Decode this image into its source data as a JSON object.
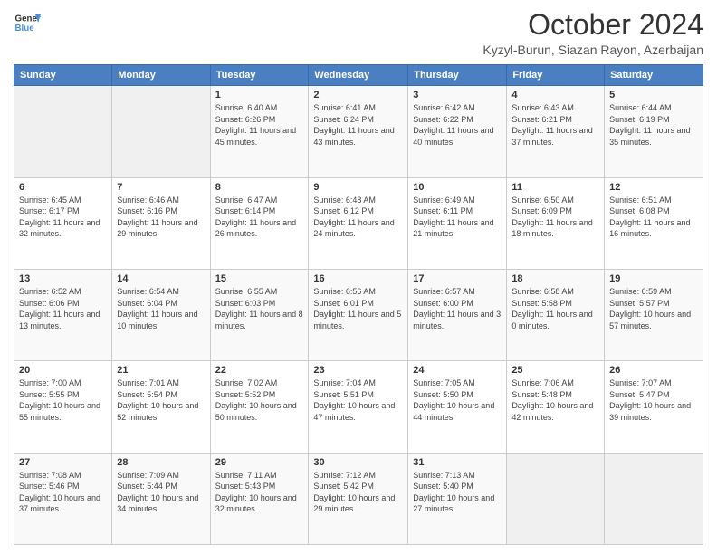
{
  "header": {
    "logo_line1": "General",
    "logo_line2": "Blue",
    "title": "October 2024",
    "subtitle": "Kyzyl-Burun, Siazan Rayon, Azerbaijan"
  },
  "columns": [
    "Sunday",
    "Monday",
    "Tuesday",
    "Wednesday",
    "Thursday",
    "Friday",
    "Saturday"
  ],
  "weeks": [
    [
      {
        "day": "",
        "info": ""
      },
      {
        "day": "",
        "info": ""
      },
      {
        "day": "1",
        "info": "Sunrise: 6:40 AM\nSunset: 6:26 PM\nDaylight: 11 hours and 45 minutes."
      },
      {
        "day": "2",
        "info": "Sunrise: 6:41 AM\nSunset: 6:24 PM\nDaylight: 11 hours and 43 minutes."
      },
      {
        "day": "3",
        "info": "Sunrise: 6:42 AM\nSunset: 6:22 PM\nDaylight: 11 hours and 40 minutes."
      },
      {
        "day": "4",
        "info": "Sunrise: 6:43 AM\nSunset: 6:21 PM\nDaylight: 11 hours and 37 minutes."
      },
      {
        "day": "5",
        "info": "Sunrise: 6:44 AM\nSunset: 6:19 PM\nDaylight: 11 hours and 35 minutes."
      }
    ],
    [
      {
        "day": "6",
        "info": "Sunrise: 6:45 AM\nSunset: 6:17 PM\nDaylight: 11 hours and 32 minutes."
      },
      {
        "day": "7",
        "info": "Sunrise: 6:46 AM\nSunset: 6:16 PM\nDaylight: 11 hours and 29 minutes."
      },
      {
        "day": "8",
        "info": "Sunrise: 6:47 AM\nSunset: 6:14 PM\nDaylight: 11 hours and 26 minutes."
      },
      {
        "day": "9",
        "info": "Sunrise: 6:48 AM\nSunset: 6:12 PM\nDaylight: 11 hours and 24 minutes."
      },
      {
        "day": "10",
        "info": "Sunrise: 6:49 AM\nSunset: 6:11 PM\nDaylight: 11 hours and 21 minutes."
      },
      {
        "day": "11",
        "info": "Sunrise: 6:50 AM\nSunset: 6:09 PM\nDaylight: 11 hours and 18 minutes."
      },
      {
        "day": "12",
        "info": "Sunrise: 6:51 AM\nSunset: 6:08 PM\nDaylight: 11 hours and 16 minutes."
      }
    ],
    [
      {
        "day": "13",
        "info": "Sunrise: 6:52 AM\nSunset: 6:06 PM\nDaylight: 11 hours and 13 minutes."
      },
      {
        "day": "14",
        "info": "Sunrise: 6:54 AM\nSunset: 6:04 PM\nDaylight: 11 hours and 10 minutes."
      },
      {
        "day": "15",
        "info": "Sunrise: 6:55 AM\nSunset: 6:03 PM\nDaylight: 11 hours and 8 minutes."
      },
      {
        "day": "16",
        "info": "Sunrise: 6:56 AM\nSunset: 6:01 PM\nDaylight: 11 hours and 5 minutes."
      },
      {
        "day": "17",
        "info": "Sunrise: 6:57 AM\nSunset: 6:00 PM\nDaylight: 11 hours and 3 minutes."
      },
      {
        "day": "18",
        "info": "Sunrise: 6:58 AM\nSunset: 5:58 PM\nDaylight: 11 hours and 0 minutes."
      },
      {
        "day": "19",
        "info": "Sunrise: 6:59 AM\nSunset: 5:57 PM\nDaylight: 10 hours and 57 minutes."
      }
    ],
    [
      {
        "day": "20",
        "info": "Sunrise: 7:00 AM\nSunset: 5:55 PM\nDaylight: 10 hours and 55 minutes."
      },
      {
        "day": "21",
        "info": "Sunrise: 7:01 AM\nSunset: 5:54 PM\nDaylight: 10 hours and 52 minutes."
      },
      {
        "day": "22",
        "info": "Sunrise: 7:02 AM\nSunset: 5:52 PM\nDaylight: 10 hours and 50 minutes."
      },
      {
        "day": "23",
        "info": "Sunrise: 7:04 AM\nSunset: 5:51 PM\nDaylight: 10 hours and 47 minutes."
      },
      {
        "day": "24",
        "info": "Sunrise: 7:05 AM\nSunset: 5:50 PM\nDaylight: 10 hours and 44 minutes."
      },
      {
        "day": "25",
        "info": "Sunrise: 7:06 AM\nSunset: 5:48 PM\nDaylight: 10 hours and 42 minutes."
      },
      {
        "day": "26",
        "info": "Sunrise: 7:07 AM\nSunset: 5:47 PM\nDaylight: 10 hours and 39 minutes."
      }
    ],
    [
      {
        "day": "27",
        "info": "Sunrise: 7:08 AM\nSunset: 5:46 PM\nDaylight: 10 hours and 37 minutes."
      },
      {
        "day": "28",
        "info": "Sunrise: 7:09 AM\nSunset: 5:44 PM\nDaylight: 10 hours and 34 minutes."
      },
      {
        "day": "29",
        "info": "Sunrise: 7:11 AM\nSunset: 5:43 PM\nDaylight: 10 hours and 32 minutes."
      },
      {
        "day": "30",
        "info": "Sunrise: 7:12 AM\nSunset: 5:42 PM\nDaylight: 10 hours and 29 minutes."
      },
      {
        "day": "31",
        "info": "Sunrise: 7:13 AM\nSunset: 5:40 PM\nDaylight: 10 hours and 27 minutes."
      },
      {
        "day": "",
        "info": ""
      },
      {
        "day": "",
        "info": ""
      }
    ]
  ]
}
